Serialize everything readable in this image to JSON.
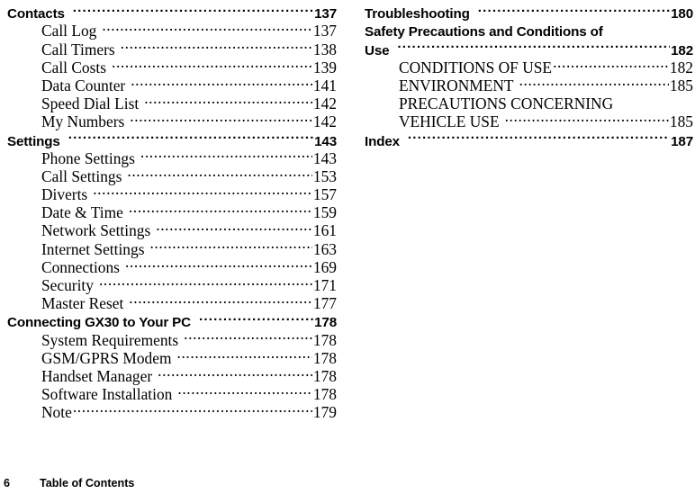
{
  "document": {
    "kind": "table-of-contents"
  },
  "footer": {
    "page_number": "6",
    "title": "Table of Contents"
  },
  "columns": {
    "left": [
      {
        "type": "heading",
        "label": "Contacts",
        "page": "137"
      },
      {
        "type": "entry",
        "label": "Call Log",
        "page": "137"
      },
      {
        "type": "entry",
        "label": "Call Timers",
        "page": "138"
      },
      {
        "type": "entry",
        "label": "Call Costs",
        "page": "139"
      },
      {
        "type": "entry",
        "label": "Data Counter",
        "page": "141"
      },
      {
        "type": "entry",
        "label": "Speed Dial List",
        "page": "142"
      },
      {
        "type": "entry",
        "label": "My Numbers",
        "page": "142"
      },
      {
        "type": "heading",
        "label": "Settings",
        "page": "143"
      },
      {
        "type": "entry",
        "label": "Phone Settings",
        "page": "143"
      },
      {
        "type": "entry",
        "label": "Call Settings",
        "page": "153"
      },
      {
        "type": "entry",
        "label": "Diverts",
        "page": "157"
      },
      {
        "type": "entry",
        "label": "Date & Time",
        "page": "159"
      },
      {
        "type": "entry",
        "label": "Network Settings",
        "page": "161"
      },
      {
        "type": "entry",
        "label": "Internet Settings",
        "page": "163"
      },
      {
        "type": "entry",
        "label": "Connections",
        "page": "169"
      },
      {
        "type": "entry",
        "label": "Security",
        "page": "171"
      },
      {
        "type": "entry",
        "label": "Master Reset",
        "page": "177"
      },
      {
        "type": "heading",
        "label": "Connecting GX30 to Your PC",
        "page": "178"
      },
      {
        "type": "entry",
        "label": "System Requirements",
        "page": "178"
      },
      {
        "type": "entry",
        "label": "GSM/GPRS Modem",
        "page": "178"
      },
      {
        "type": "entry",
        "label": "Handset Manager",
        "page": "178"
      },
      {
        "type": "entry",
        "label": "Software Installation",
        "page": "178"
      },
      {
        "type": "entry",
        "label": "Note",
        "page": "179",
        "tight": true
      }
    ],
    "right": [
      {
        "type": "heading",
        "label": "Troubleshooting",
        "page": "180"
      },
      {
        "type": "heading",
        "label": "Safety Precautions and Conditions of",
        "wrap_first": true
      },
      {
        "type": "heading",
        "label": "Use",
        "page": "182"
      },
      {
        "type": "entry",
        "label": "CONDITIONS OF USE",
        "page": "182",
        "tight": true
      },
      {
        "type": "entry",
        "label": "ENVIRONMENT",
        "page": "185"
      },
      {
        "type": "entry",
        "label": "PRECAUTIONS CONCERNING",
        "wrap_first": true
      },
      {
        "type": "entry",
        "label": "VEHICLE USE",
        "page": "185"
      },
      {
        "type": "heading",
        "label": "Index",
        "page": "187"
      }
    ]
  }
}
